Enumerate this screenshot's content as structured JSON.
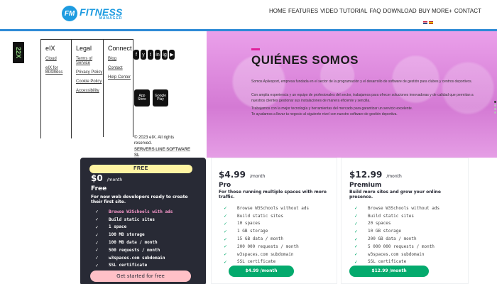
{
  "header": {
    "logo_badge": "FM",
    "logo_title": "FITNESS",
    "logo_sub": "MANAGER",
    "nav": [
      "HOME",
      "FEATURES",
      "VIDEO TUTORIAL",
      "FAQ",
      "DOWNLOAD",
      "BUY MORE+",
      "CONTACT"
    ],
    "accent_color": "#2e8bd6"
  },
  "footer": {
    "brand_mark": "22X",
    "columns": [
      {
        "title": "eIX",
        "links": [
          "Cloud",
          "eIX for Business"
        ]
      },
      {
        "title": "Legal",
        "links": [
          "Terms of Service",
          "Privacy Policy",
          "Cookie Policy",
          "Accessibility"
        ]
      },
      {
        "title": "Connect",
        "links": [
          "Blog",
          "Contact",
          "Help Center"
        ]
      }
    ],
    "social": [
      "f",
      "y",
      "t",
      "in",
      "ig",
      "▶"
    ],
    "stores": [
      "App Store",
      "Google Play"
    ],
    "copyright_1": "© 2023 eIX. All rights reserved.",
    "copyright_2": "SERVERS LINE SOFTWARE SL"
  },
  "about": {
    "title": "QUIÉNES SOMOS",
    "p1": "Somos Apliesport, empresa fundada en el sector de la programación y el desarrollo de software de gestión para clubes y centros deportivos.",
    "p2": "Con amplia experiencia y un equipo de profesionales del sector, trabajamos para ofrecer soluciones innovadoras y de calidad que permitan a nuestros clientes gestionar sus instalaciones de manera eficiente y sencilla.",
    "p3": "Trabajamos con la mejor tecnología y herramientas del mercado para garantizar un servicio excelente.",
    "p4": "Te ayudamos a llevar tu negocio al siguiente nivel con nuestro software de gestión deportiva.",
    "accent": "#e0219b"
  },
  "pricing": {
    "free": {
      "badge": "FREE",
      "price": "$0",
      "per": "/month",
      "name": "Free",
      "desc": "For new web developers ready to create their first site.",
      "features": [
        "Browse W3Schools with ads",
        "Build static sites",
        "1 space",
        "100 MB storage",
        "100 MB data / month",
        "500 requests / month",
        "w3spaces.com subdomain",
        "SSL certificate"
      ],
      "button": "Get started for free"
    },
    "pro": {
      "price": "$4.99",
      "per": "/month",
      "name": "Pro",
      "desc": "For those running multiple spaces with more traffic.",
      "features": [
        "Browse W3Schools without ads",
        "Build static sites",
        "10 spaces",
        "1 GB storage",
        "15 GB data / month",
        "200 000 requests / month",
        "w3spaces.com subdomain",
        "SSL certificate"
      ],
      "button": "$4.99 /month"
    },
    "premium": {
      "price": "$12.99",
      "per": "/month",
      "name": "Premium",
      "desc": "Build more sites and grow your online presence.",
      "features": [
        "Browse W3Schools without ads",
        "Build static sites",
        "20 spaces",
        "10 GB storage",
        "200 GB data / month",
        "5 000 000 requests / month",
        "w3spaces.com subdomain",
        "SSL certificate"
      ],
      "button": "$12.99 /month"
    }
  }
}
